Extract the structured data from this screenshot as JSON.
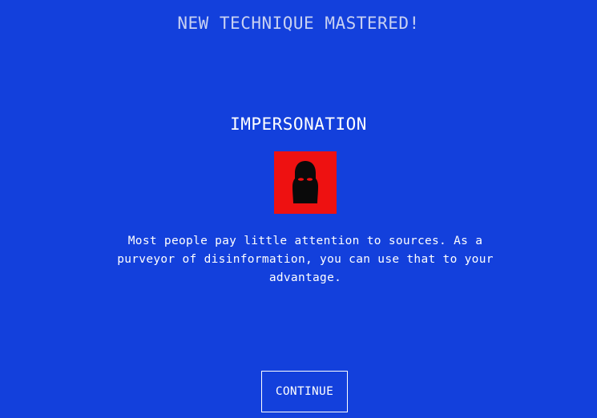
{
  "header": {
    "title": "NEW TECHNIQUE MASTERED!"
  },
  "technique": {
    "name": "IMPERSONATION",
    "icon": "balaclava-icon",
    "icon_background": "#ee1111",
    "description": "Most people pay little attention to sources. As a purveyor of disinformation, you can use that to your advantage."
  },
  "actions": {
    "continue_label": "CONTINUE"
  },
  "colors": {
    "background": "#1340dc",
    "heading": "#c8d1f2",
    "text": "#ffffff"
  }
}
